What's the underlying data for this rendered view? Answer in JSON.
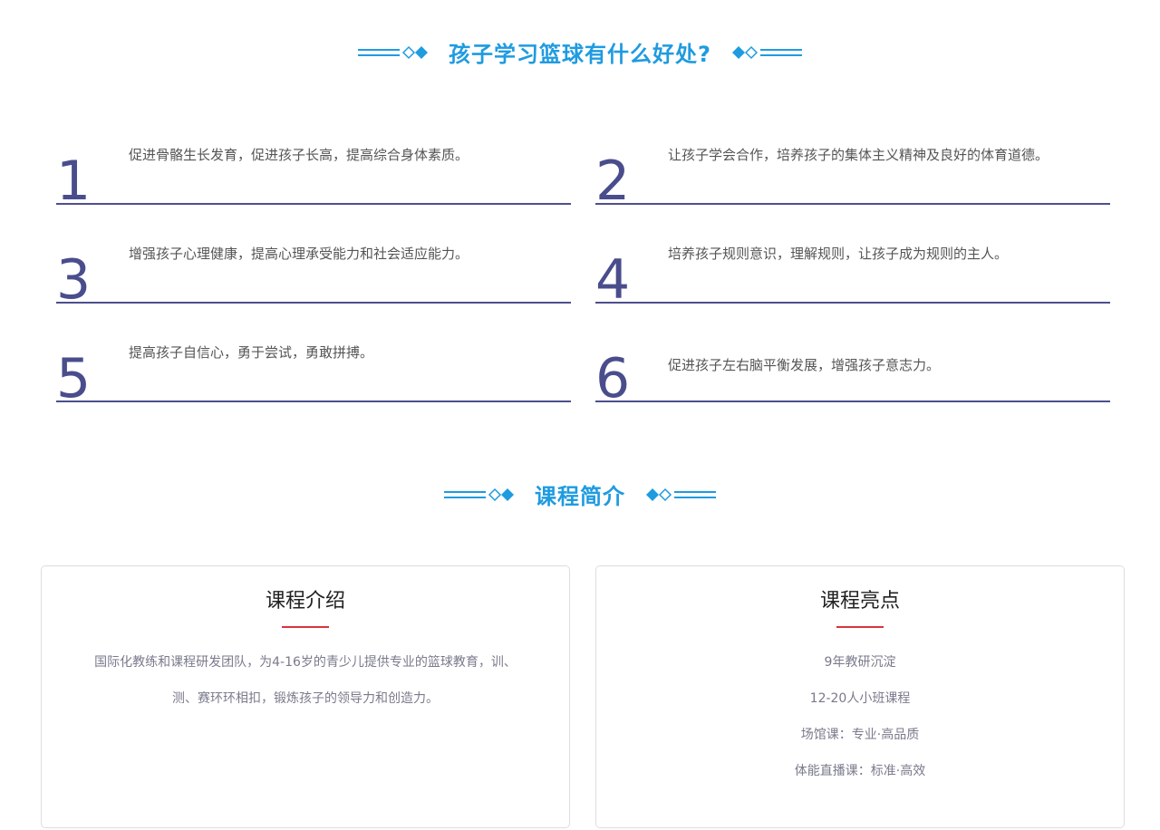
{
  "benefits_section": {
    "title": "孩子学习篮球有什么好处?",
    "items": [
      {
        "num": "1",
        "text": "促进骨骼生长发育，促进孩子长高，提高综合身体素质。"
      },
      {
        "num": "2",
        "text": "让孩子学会合作，培养孩子的集体主义精神及良好的体育道德。"
      },
      {
        "num": "3",
        "text": "增强孩子心理健康，提高心理承受能力和社会适应能力。"
      },
      {
        "num": "4",
        "text": "培养孩子规则意识，理解规则，让孩子成为规则的主人。"
      },
      {
        "num": "5",
        "text": "提高孩子自信心，勇于尝试，勇敢拼搏。"
      },
      {
        "num": "6",
        "text": "促进孩子左右脑平衡发展，增强孩子意志力。"
      }
    ]
  },
  "course_section": {
    "title": "课程简介",
    "intro_card": {
      "title": "课程介绍",
      "lines": [
        "国际化教练和课程研发团队，为4-16岁的青少儿提供专业的篮球教育，训、",
        "测、赛环环相扣，锻炼孩子的领导力和创造力。"
      ]
    },
    "highlights_card": {
      "title": "课程亮点",
      "lines": [
        "9年教研沉淀",
        "12-20人小班课程",
        "场馆课：专业·高品质",
        "体能直播课：标准·高效"
      ]
    }
  },
  "colors": {
    "accent_blue": "#1f9be0",
    "number_navy": "#4a4d8c",
    "underline_red": "#d9343d"
  }
}
